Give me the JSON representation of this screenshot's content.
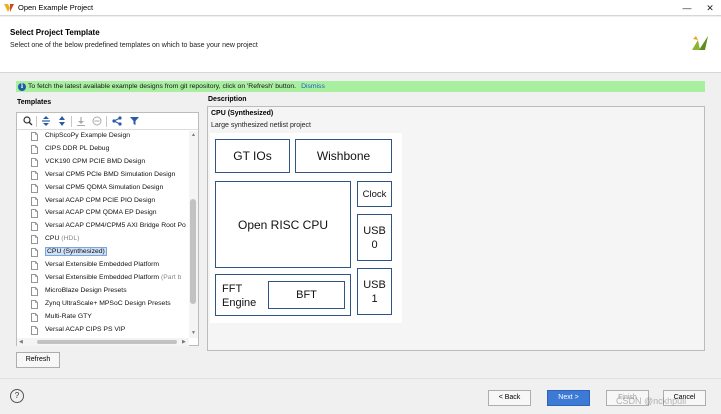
{
  "window": {
    "title": "Open Example Project",
    "minimize": "—",
    "close": "✕"
  },
  "header": {
    "title": "Select Project Template",
    "subtitle": "Select one of the below predefined templates on which to base your new project"
  },
  "banner": {
    "text": "To fetch the latest available example designs from git repository, click on 'Refresh' button.",
    "link": "Dismiss",
    "icon": "info-icon"
  },
  "templates": {
    "label": "Templates",
    "toolbar": [
      "search-icon",
      "collapse-all-icon",
      "expand-all-icon",
      "download-icon",
      "remove-icon",
      "share-icon",
      "filter-icon"
    ],
    "items": [
      {
        "label": "ChipScoPy Example Design",
        "suffix": ""
      },
      {
        "label": "CIPS DDR PL Debug",
        "suffix": ""
      },
      {
        "label": "VCK190 CPM PCIE BMD Design",
        "suffix": ""
      },
      {
        "label": "Versal CPM5 PCIe BMD Simulation Design",
        "suffix": ""
      },
      {
        "label": "Versal CPM5 QDMA Simulation Design",
        "suffix": ""
      },
      {
        "label": "Versal ACAP CPM PCIE PIO Design",
        "suffix": ""
      },
      {
        "label": "Versal ACAP CPM QDMA EP Design",
        "suffix": ""
      },
      {
        "label": "Versal ACAP CPM4/CPM5 AXI Bridge Root Po",
        "suffix": ""
      },
      {
        "label": "CPU",
        "suffix": "(HDL)"
      },
      {
        "label": "CPU (Synthesized)",
        "suffix": "",
        "selected": true
      },
      {
        "label": "Versal Extensible Embedded Platform",
        "suffix": ""
      },
      {
        "label": "Versal Extensible Embedded Platform",
        "suffix": "(Part b"
      },
      {
        "label": "MicroBlaze Design Presets",
        "suffix": ""
      },
      {
        "label": "Zynq UltraScale+ MPSoC Design Presets",
        "suffix": ""
      },
      {
        "label": "Multi-Rate GTY",
        "suffix": ""
      },
      {
        "label": "Versal ACAP CIPS PS VIP",
        "suffix": ""
      }
    ],
    "refresh_label": "Refresh"
  },
  "description": {
    "label": "Description",
    "title": "CPU (Synthesized)",
    "subtitle": "Large synthesized netlist project",
    "blocks": {
      "gt_ios": "GT IOs",
      "wishbone": "Wishbone",
      "clock": "Clock",
      "cpu": "Open RISC CPU",
      "usb0_line1": "USB",
      "usb0_line2": "0",
      "usb1_line1": "USB",
      "usb1_line2": "1",
      "fft_line1": "FFT",
      "fft_line2": "Engine",
      "bft": "BFT"
    }
  },
  "footer": {
    "help": "?",
    "back": "< Back",
    "next": "Next >",
    "finish": "Finish",
    "cancel": "Cancel",
    "watermark": "CSDN @nckhpull"
  },
  "colors": {
    "accent": "#3d7ad6",
    "banner": "#a8f0a0",
    "link": "#1f58c5",
    "block_border": "#2e5584"
  }
}
